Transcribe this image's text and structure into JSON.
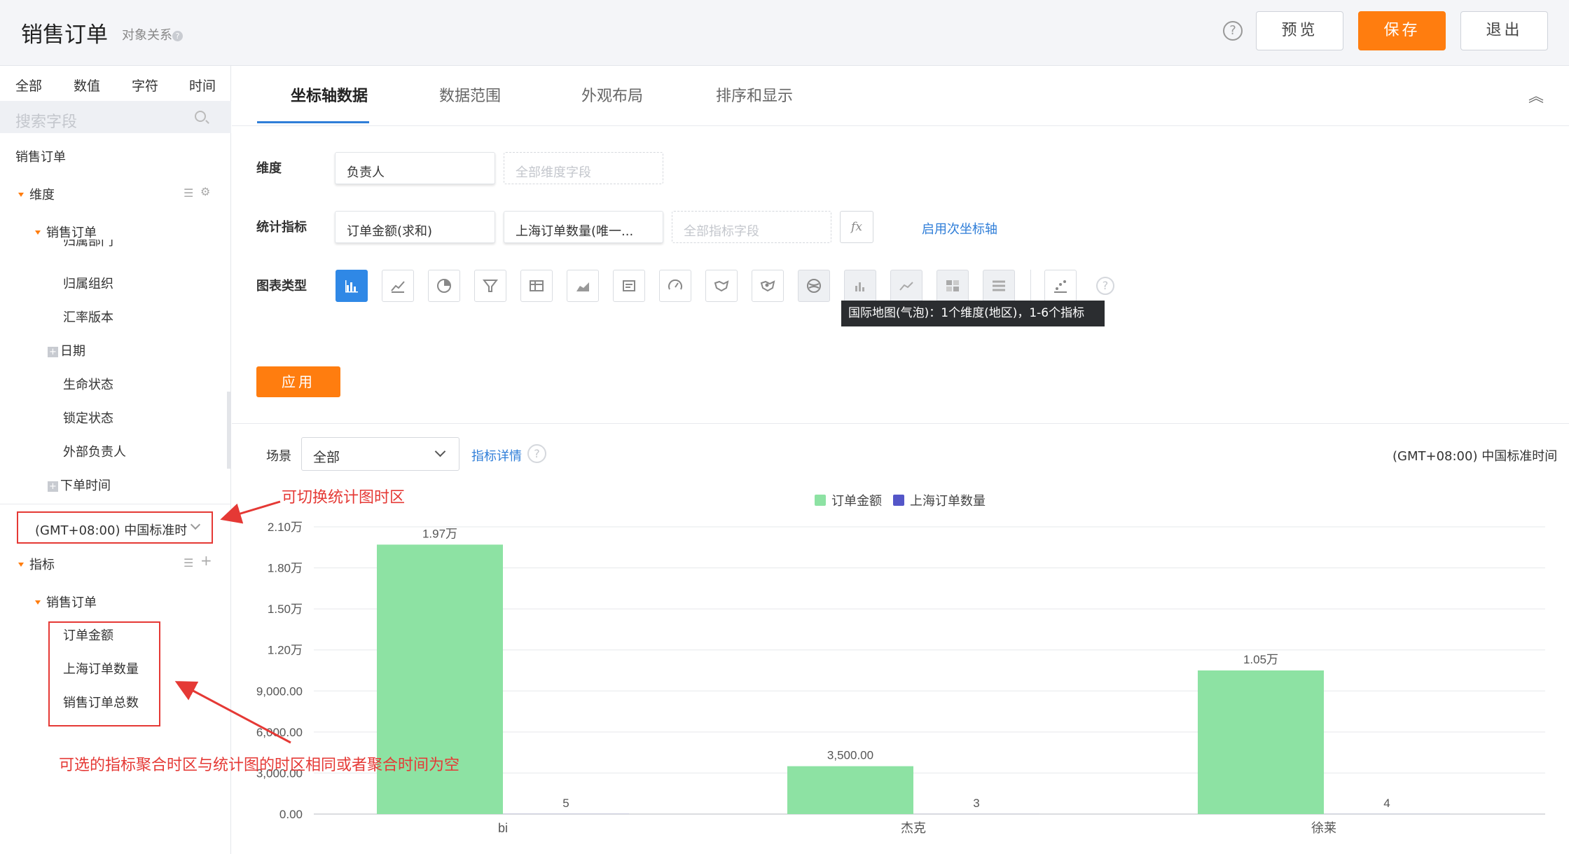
{
  "header": {
    "title": "销售订单",
    "relation_label": "对象关系",
    "help": "?",
    "preview": "预览",
    "save": "保存",
    "exit": "退出"
  },
  "left": {
    "tabs": [
      "全部",
      "数值",
      "字符",
      "时间"
    ],
    "search_placeholder": "搜索字段",
    "source": "销售订单",
    "dimension_group": "维度",
    "dimension_sub": "销售订单",
    "dimension_items": [
      "归属部门",
      "归属组织",
      "汇率版本",
      "日期",
      "生命状态",
      "锁定状态",
      "外部负责人",
      "下单时间"
    ],
    "timezone": "(GMT+08:00) 中国标准时",
    "metric_group": "指标",
    "metric_sub": "销售订单",
    "metric_items": [
      "订单金额",
      "上海订单数量",
      "销售订单总数"
    ]
  },
  "tabs": [
    "坐标轴数据",
    "数据范围",
    "外观布局",
    "排序和显示"
  ],
  "config": {
    "dimension_label": "维度",
    "dimension_value": "负责人",
    "dimension_placeholder": "全部维度字段",
    "metric_label": "统计指标",
    "metric_values": [
      "订单金额(求和)",
      "上海订单数量(唯一..."
    ],
    "metric_placeholder": "全部指标字段",
    "fx": "fx",
    "secondary_axis": "启用次坐标轴",
    "chart_type_label": "图表类型",
    "chart_types": [
      "bar-chart-icon",
      "line-chart-icon",
      "pie-chart-icon",
      "funnel-chart-icon",
      "table-icon",
      "area-chart-icon",
      "card-icon",
      "gauge-icon",
      "map-icon",
      "map-bubble-icon",
      "world-map-icon",
      "column-chart-icon",
      "line-chart-2-icon",
      "heatmap-icon",
      "list-icon",
      "scatter-icon"
    ],
    "tooltip": "国际地图(气泡)：1个维度(地区)，1-6个指标",
    "apply": "应用"
  },
  "chart_area": {
    "scene_label": "场景",
    "scene_value": "全部",
    "metric_detail": "指标详情",
    "timezone": "(GMT+08:00) 中国标准时间"
  },
  "annotations": {
    "timezone_note": "可切换统计图时区",
    "metric_note": "可选的指标聚合时区与统计图的时区相同或者聚合时间为空"
  },
  "chart_data": {
    "type": "bar",
    "categories": [
      "bi",
      "杰克",
      "徐莱"
    ],
    "series": [
      {
        "name": "订单金额",
        "values": [
          19700,
          3500,
          10500
        ],
        "labels": [
          "1.97万",
          "3,500.00",
          "1.05万"
        ],
        "color": "#8de2a3"
      },
      {
        "name": "上海订单数量",
        "values": [
          5,
          3,
          4
        ],
        "labels": [
          "5",
          "3",
          "4"
        ],
        "color": "#5456c8"
      }
    ],
    "yticks": [
      "0.00",
      "3,000.00",
      "6,000.00",
      "9,000.00",
      "1.20万",
      "1.50万",
      "1.80万",
      "2.10万"
    ],
    "ytick_values": [
      0,
      3000,
      6000,
      9000,
      12000,
      15000,
      18000,
      21000
    ],
    "ylim": [
      0,
      21000
    ],
    "legend": "top-center",
    "grid": true
  }
}
